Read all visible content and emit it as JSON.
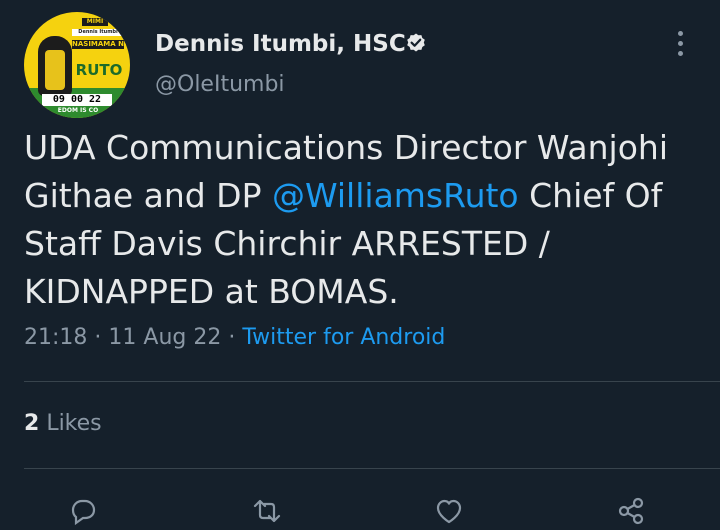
{
  "tweet": {
    "author": {
      "name": "Dennis Itumbi, HSC",
      "handle": "@OleItumbi",
      "avatar_text": {
        "line1": "MIMI",
        "line2": "Dennis Itumbi",
        "line3": "NASIMAMA NA",
        "line4": "RUTO",
        "clock": "09 00 22",
        "slogan": "EDOM IS CO"
      }
    },
    "text_part1": "UDA Communications Director Wanjohi Githae and DP ",
    "mention": "@WilliamsRuto",
    "text_part2": " Chief Of Staff Davis Chirchir ARRESTED / KIDNAPPED at BOMAS.",
    "time": "21:18",
    "separator": "·",
    "date": "11 Aug 22",
    "source": "Twitter for Android",
    "likes_count": "2",
    "likes_label": "Likes"
  },
  "icons": {
    "verified": "verified-badge-icon",
    "more": "more-vertical-icon",
    "actions": [
      "reply-icon",
      "retweet-icon",
      "like-icon",
      "share-icon"
    ]
  },
  "colors": {
    "background": "#15202b",
    "text": "#e7e9ea",
    "secondary": "#8b98a5",
    "link": "#1d9bf0",
    "divider": "#38444d"
  }
}
